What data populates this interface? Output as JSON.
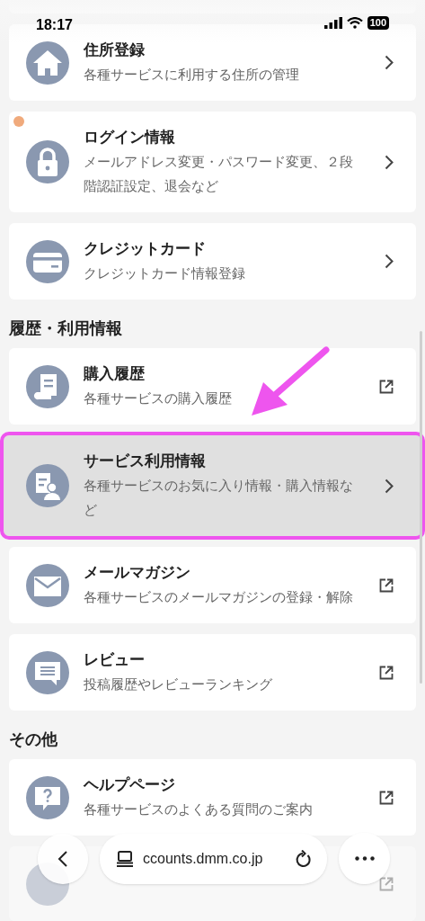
{
  "status_bar": {
    "time": "18:17",
    "battery": "100"
  },
  "sections": [
    {
      "items": [
        {
          "title": "住所登録",
          "subtitle": "各種サービスに利用する住所の管理",
          "kind": "chevron",
          "selected": false,
          "highlighted": false,
          "notice": false,
          "obscured": false
        },
        {
          "title": "ログイン情報",
          "subtitle": "メールアドレス変更・パスワード変更、２段階認証設定、退会など",
          "kind": "chevron",
          "selected": false,
          "highlighted": false,
          "notice": true,
          "obscured": false
        },
        {
          "title": "クレジットカード",
          "subtitle": "クレジットカード情報登録",
          "kind": "chevron",
          "selected": false,
          "highlighted": false,
          "notice": false,
          "obscured": false
        }
      ]
    },
    {
      "heading": "履歴・利用情報",
      "items": [
        {
          "title": "購入履歴",
          "subtitle": "各種サービスの購入履歴",
          "kind": "external",
          "selected": false,
          "highlighted": false,
          "notice": false,
          "obscured": false
        },
        {
          "title": "サービス利用情報",
          "subtitle": "各種サービスのお気に入り情報・購入情報など",
          "kind": "chevron",
          "selected": true,
          "highlighted": true,
          "notice": false,
          "obscured": false
        },
        {
          "title": "メールマガジン",
          "subtitle": "各種サービスのメールマガジンの登録・解除",
          "kind": "external",
          "selected": false,
          "highlighted": false,
          "notice": false,
          "obscured": false
        },
        {
          "title": "レビュー",
          "subtitle": "投稿履歴やレビューランキング",
          "kind": "external",
          "selected": false,
          "highlighted": false,
          "notice": false,
          "obscured": false
        }
      ]
    },
    {
      "heading": "その他",
      "items": [
        {
          "title": "ヘルプページ",
          "subtitle": "各種サービスのよくある質問のご案内",
          "kind": "external",
          "selected": false,
          "highlighted": false,
          "notice": false,
          "obscured": false
        },
        {
          "kind": "external",
          "selected": false,
          "highlighted": false,
          "notice": false,
          "obscured": true
        }
      ]
    }
  ],
  "toolbar": {
    "url": "ccounts.dmm.co.jp"
  }
}
